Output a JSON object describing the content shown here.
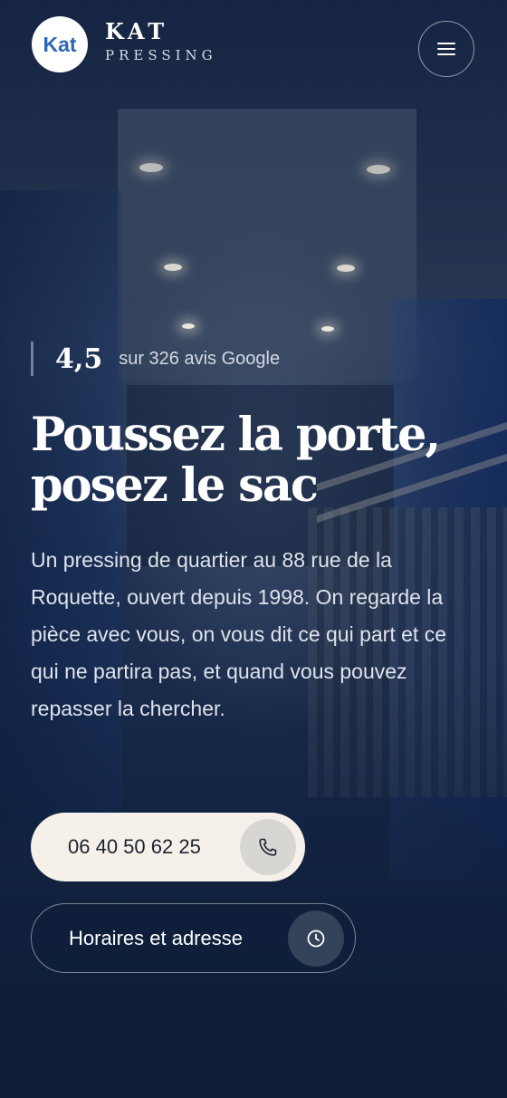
{
  "header": {
    "logo_text": "Kat",
    "brand_name": "KAT",
    "brand_sub": "PRESSING",
    "menu_icon": "hamburger-icon"
  },
  "hero": {
    "rating_score": "4,5",
    "rating_text": "sur 326 avis Google",
    "headline": "Poussez la porte, posez le sac",
    "intro": "Un pressing de quartier au 88 rue de la Roquette, ouvert depuis 1998. On regarde la pièce avec vous, on vous dit ce qui part et ce qui ne partira pas, et quand vous pouvez repasser la chercher.",
    "call_label": "06 40 50 62 25",
    "call_icon": "phone-icon",
    "hours_label": "Horaires et adresse",
    "hours_icon": "clock-icon"
  },
  "colors": {
    "background": "#0f1f3a",
    "logo_accent": "#2c68b6",
    "call_button": "#f5f1ea"
  }
}
